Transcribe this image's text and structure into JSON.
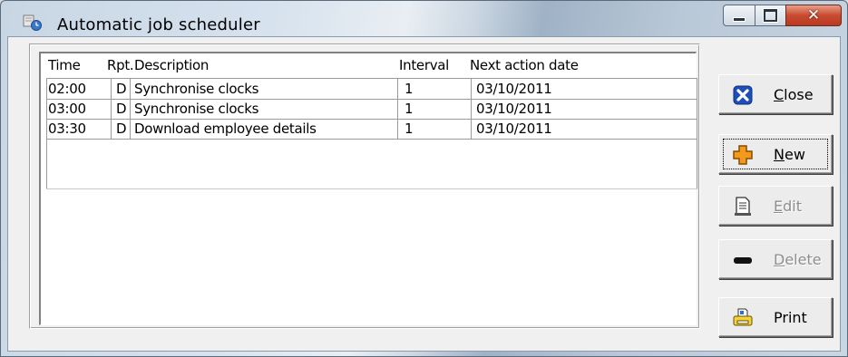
{
  "window": {
    "title": "Automatic job scheduler"
  },
  "table": {
    "columns": [
      "Time",
      "Rpt.",
      "Description",
      "Interval",
      "Next action date"
    ],
    "rows": [
      {
        "time": "02:00",
        "rpt": "D",
        "description": "Synchronise clocks",
        "interval": "1",
        "next": "03/10/2011"
      },
      {
        "time": "03:00",
        "rpt": "D",
        "description": "Synchronise clocks",
        "interval": "1",
        "next": "03/10/2011"
      },
      {
        "time": "03:30",
        "rpt": "D",
        "description": "Download employee details",
        "interval": "1",
        "next": "03/10/2011"
      }
    ]
  },
  "buttons": {
    "close": {
      "label": "Close",
      "icon": "close-x-icon",
      "enabled": true
    },
    "new": {
      "label": "New",
      "icon": "plus-icon",
      "enabled": true,
      "focused": true
    },
    "edit": {
      "label": "Edit",
      "icon": "document-edit-icon",
      "enabled": false
    },
    "delete": {
      "label": "Delete",
      "icon": "minus-icon",
      "enabled": false
    },
    "print": {
      "label": "Print",
      "icon": "printer-icon",
      "enabled": true
    }
  },
  "colors": {
    "close_icon_blue": "#1e4fb8",
    "new_icon_orange": "#f29a1c",
    "print_icon_yellow": "#f4d23c"
  }
}
